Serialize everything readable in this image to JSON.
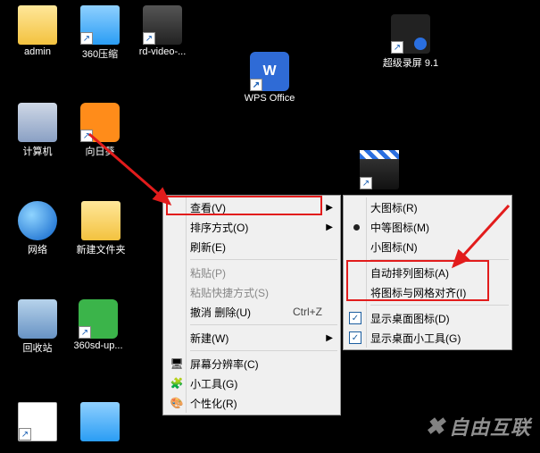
{
  "desktop": {
    "icons": [
      {
        "label": "admin"
      },
      {
        "label": "360压缩"
      },
      {
        "label": "rd-video-..."
      },
      {
        "label": "WPS Office"
      },
      {
        "label": "超级录屏 9.1"
      },
      {
        "label": "计算机"
      },
      {
        "label": "向日葵"
      },
      {
        "label": "网络"
      },
      {
        "label": "新建文件夹"
      },
      {
        "label": "回收站"
      },
      {
        "label": "360sd-up..."
      }
    ]
  },
  "context_menu": {
    "view": "查看(V)",
    "sort": "排序方式(O)",
    "refresh": "刷新(E)",
    "paste": "粘贴(P)",
    "paste_shortcut": "粘贴快捷方式(S)",
    "undo_delete": "撤消 删除(U)",
    "undo_shortcut": "Ctrl+Z",
    "new": "新建(W)",
    "screen_res": "屏幕分辨率(C)",
    "gadgets": "小工具(G)",
    "personalize": "个性化(R)"
  },
  "submenu": {
    "large": "大图标(R)",
    "medium": "中等图标(M)",
    "small": "小图标(N)",
    "auto_arrange": "自动排列图标(A)",
    "align_grid": "将图标与网格对齐(I)",
    "show_icons": "显示桌面图标(D)",
    "show_gadgets": "显示桌面小工具(G)"
  },
  "watermark": "自由互联"
}
